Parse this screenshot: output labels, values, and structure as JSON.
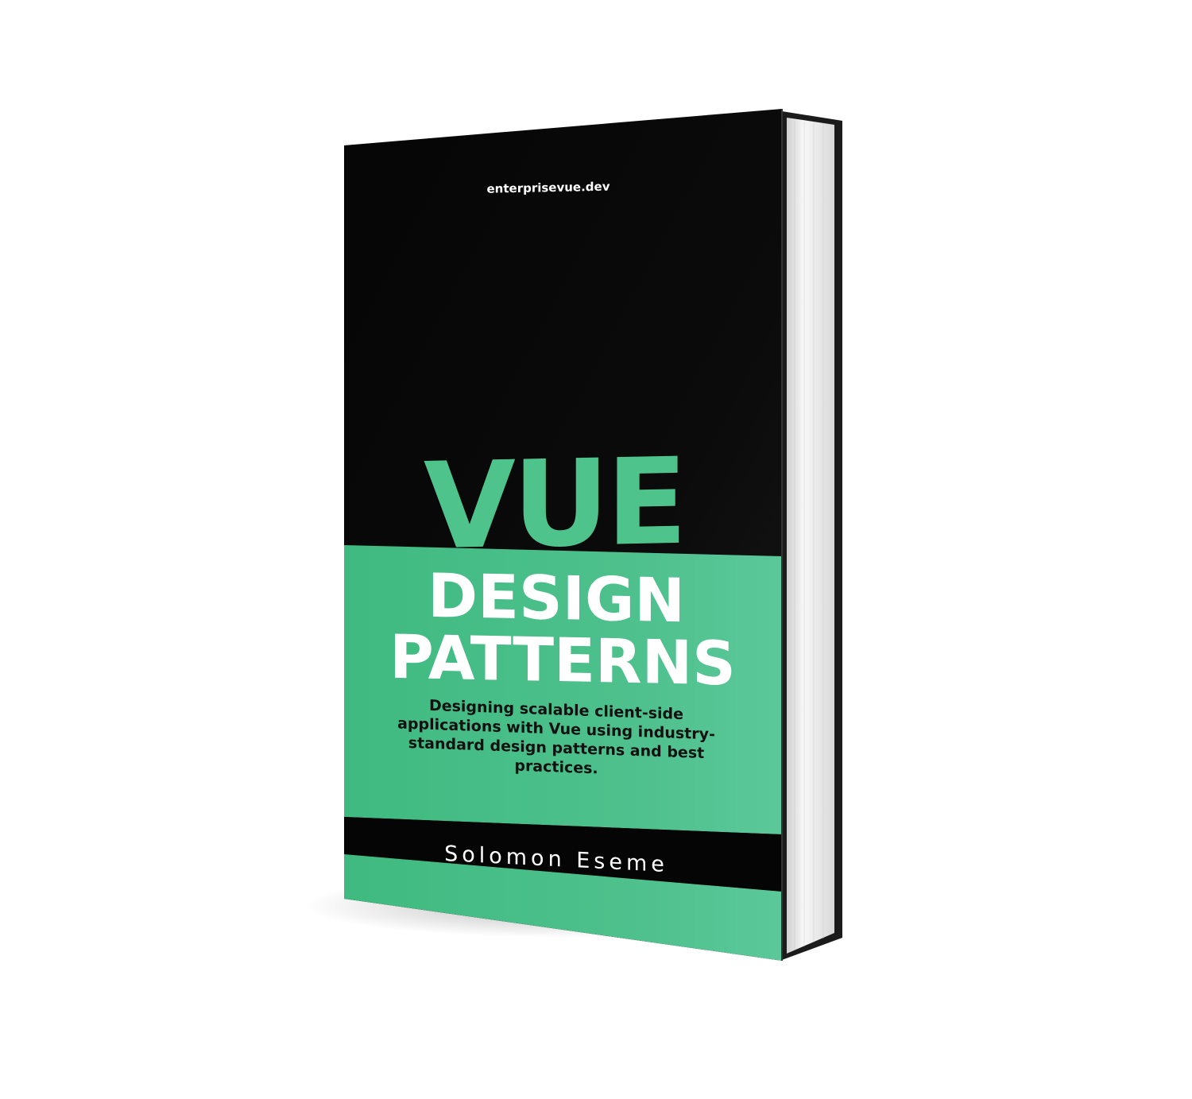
{
  "book": {
    "website": "enterprisevue.dev",
    "title_word_1": "VUE",
    "title_word_2": "DESIGN",
    "title_word_3": "PATTERNS",
    "subtitle_lines": [
      "Designing scalable client-side",
      "applications with Vue using industry-",
      "standard design patterns and best",
      "practices."
    ],
    "author": "Solomon Eseme"
  },
  "colors": {
    "cover_black": "#0a0a0a",
    "cover_green": "#4ebd8a",
    "title_green": "#4ec48c",
    "text_white": "#ffffff",
    "spine_dark": "#111111",
    "pages": "#eeeeee"
  }
}
